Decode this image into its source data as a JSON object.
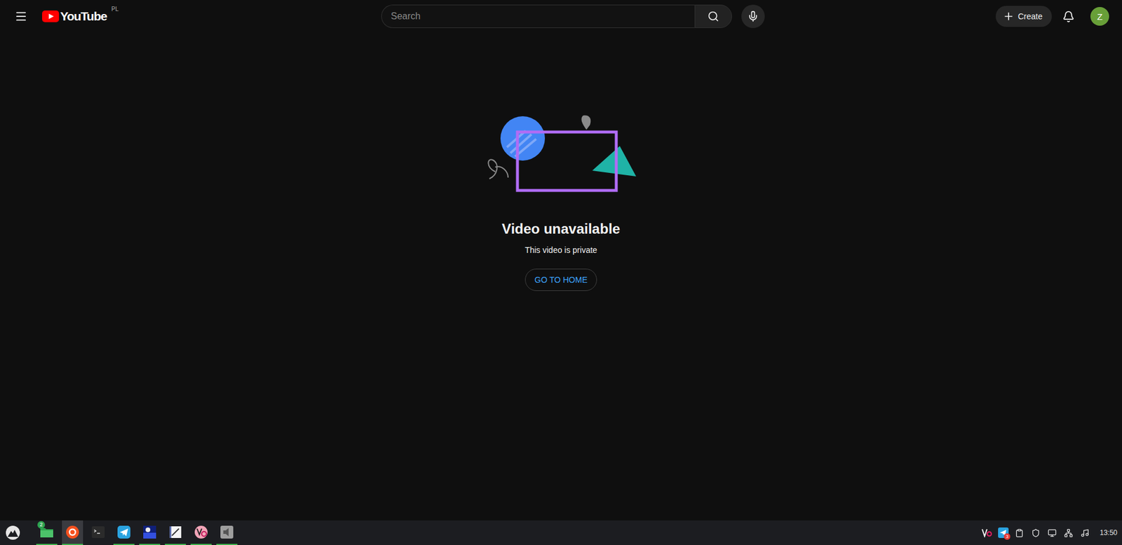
{
  "header": {
    "logo": "YouTube",
    "country": "PL",
    "search": {
      "placeholder": "Search"
    },
    "create": "Create",
    "avatar": "Z"
  },
  "error": {
    "title": "Video unavailable",
    "message": "This video is private",
    "button": "GO TO HOME"
  },
  "taskbar": {
    "apps": [
      {
        "kind": "files",
        "badge": "2",
        "selected": false,
        "running": true
      },
      {
        "kind": "browser",
        "badge": "",
        "selected": true,
        "running": true
      },
      {
        "kind": "terminal",
        "badge": "",
        "selected": false,
        "running": false
      },
      {
        "kind": "telegram",
        "badge": "",
        "selected": false,
        "running": true
      },
      {
        "kind": "ghost",
        "badge": "",
        "selected": false,
        "running": true
      },
      {
        "kind": "editor",
        "badge": "",
        "selected": false,
        "running": true
      },
      {
        "kind": "vc",
        "badge": "",
        "selected": false,
        "running": true
      },
      {
        "kind": "mixer",
        "badge": "",
        "selected": false,
        "running": true
      }
    ],
    "tray": [
      {
        "kind": "vc",
        "badge": ""
      },
      {
        "kind": "telegram",
        "badge": "3"
      },
      {
        "kind": "clipboard",
        "badge": ""
      },
      {
        "kind": "shield",
        "badge": ""
      },
      {
        "kind": "display",
        "badge": ""
      },
      {
        "kind": "network",
        "badge": ""
      },
      {
        "kind": "music",
        "badge": ""
      }
    ],
    "clock": "13:50"
  }
}
